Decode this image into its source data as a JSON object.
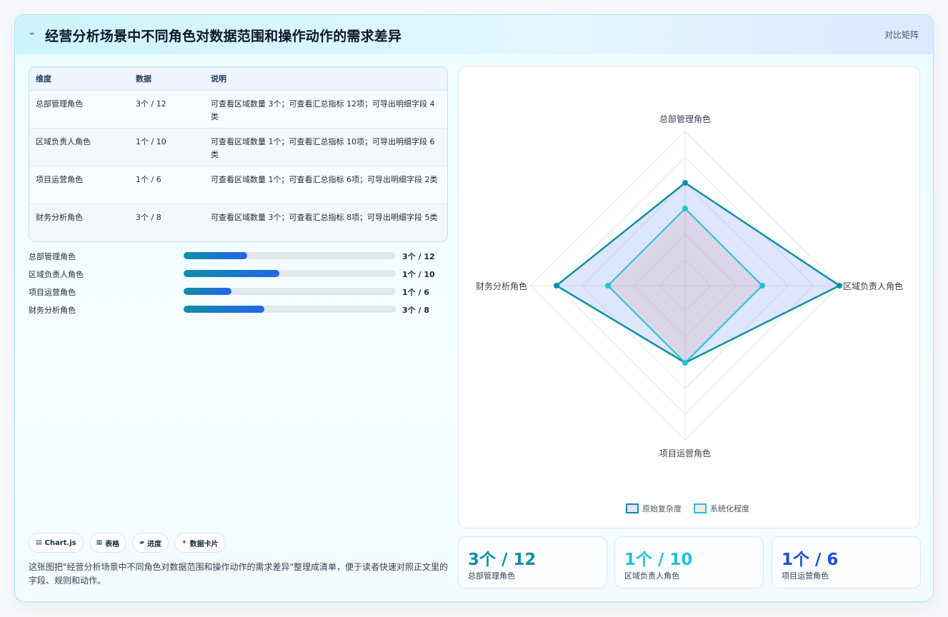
{
  "header": {
    "icon": "lightning-icon",
    "title": "经营分析场景中不同角色对数据范围和操作动作的需求差异",
    "right_label": "对比矩阵"
  },
  "table": {
    "headers": [
      "维度",
      "数据",
      "说明"
    ],
    "rows": [
      {
        "name": "总部管理角色",
        "data": "3个 / 12",
        "desc": "可查看区域数量 3个；可查看汇总指标 12项；可导出明细字段 4类"
      },
      {
        "name": "区域负责人角色",
        "data": "1个 / 10",
        "desc": "可查看区域数量 1个；可查看汇总指标 10项；可导出明细字段 6类"
      },
      {
        "name": "项目运营角色",
        "data": "1个 / 6",
        "desc": "可查看区域数量 1个；可查看汇总指标 6项；可导出明细字段 2类"
      },
      {
        "name": "财务分析角色",
        "data": "3个 / 8",
        "desc": "可查看区域数量 3个；可查看汇总指标 8项；可导出明细字段 5类"
      }
    ]
  },
  "progress": [
    {
      "label": "总部管理角色",
      "value": "3个 / 12",
      "fraction": 0.3
    },
    {
      "label": "区域负责人角色",
      "value": "1个 / 10",
      "fraction": 0.45
    },
    {
      "label": "项目运营角色",
      "value": "1个 / 6",
      "fraction": 0.225
    },
    {
      "label": "财务分析角色",
      "value": "3个 / 8",
      "fraction": 0.38
    }
  ],
  "tags": [
    {
      "icon": "chart-icon",
      "glyph": "▤",
      "label": "Chart.js"
    },
    {
      "icon": "table-icon",
      "glyph": "▦",
      "label": "表格"
    },
    {
      "icon": "progress-icon",
      "glyph": "▰",
      "label": "进度"
    },
    {
      "icon": "sparkle-icon",
      "glyph": "✦",
      "label": "数据卡片"
    }
  ],
  "description": "这张图把\"经营分析场景中不同角色对数据范围和操作动作的需求差异\"整理成清单，便于读者快速对照正文里的字段、规则和动作。",
  "stats": [
    {
      "value": "3个 / 12",
      "label": "总部管理角色",
      "color": "#0e8fa8"
    },
    {
      "value": "1个 / 10",
      "label": "区域负责人角色",
      "color": "#22c1dc"
    },
    {
      "value": "1个 / 6",
      "label": "项目运营角色",
      "color": "#1d4ed8"
    }
  ],
  "colors": {
    "series1": "#0e8fa8",
    "series2": "#22c1dc",
    "fill1": "rgba(100,140,235,0.22)",
    "fill2": "rgba(210,160,160,0.22)"
  },
  "chart_data": {
    "type": "radar",
    "categories": [
      "总部管理角色",
      "区域负责人角色",
      "项目运营角色",
      "财务分析角色"
    ],
    "series": [
      {
        "name": "原始复杂度",
        "values": [
          4,
          6,
          3,
          5
        ]
      },
      {
        "name": "系统化程度",
        "values": [
          3,
          3,
          3,
          3
        ]
      }
    ],
    "rlim": [
      0,
      6
    ],
    "grid": true,
    "legend": "bottom"
  }
}
